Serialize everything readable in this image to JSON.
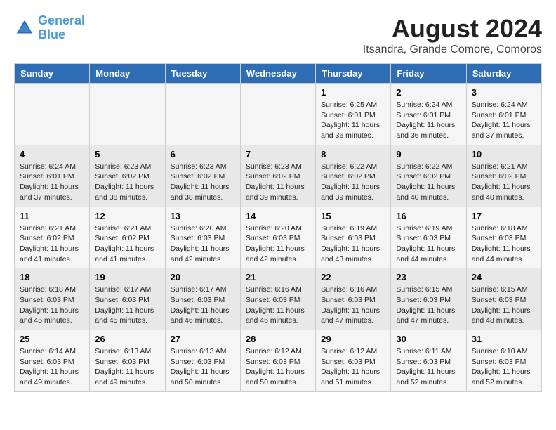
{
  "header": {
    "logo_line1": "General",
    "logo_line2": "Blue",
    "month_year": "August 2024",
    "location": "Itsandra, Grande Comore, Comoros"
  },
  "weekdays": [
    "Sunday",
    "Monday",
    "Tuesday",
    "Wednesday",
    "Thursday",
    "Friday",
    "Saturday"
  ],
  "weeks": [
    [
      {
        "day": "",
        "info": ""
      },
      {
        "day": "",
        "info": ""
      },
      {
        "day": "",
        "info": ""
      },
      {
        "day": "",
        "info": ""
      },
      {
        "day": "1",
        "info": "Sunrise: 6:25 AM\nSunset: 6:01 PM\nDaylight: 11 hours and 36 minutes."
      },
      {
        "day": "2",
        "info": "Sunrise: 6:24 AM\nSunset: 6:01 PM\nDaylight: 11 hours and 36 minutes."
      },
      {
        "day": "3",
        "info": "Sunrise: 6:24 AM\nSunset: 6:01 PM\nDaylight: 11 hours and 37 minutes."
      }
    ],
    [
      {
        "day": "4",
        "info": "Sunrise: 6:24 AM\nSunset: 6:01 PM\nDaylight: 11 hours and 37 minutes."
      },
      {
        "day": "5",
        "info": "Sunrise: 6:23 AM\nSunset: 6:02 PM\nDaylight: 11 hours and 38 minutes."
      },
      {
        "day": "6",
        "info": "Sunrise: 6:23 AM\nSunset: 6:02 PM\nDaylight: 11 hours and 38 minutes."
      },
      {
        "day": "7",
        "info": "Sunrise: 6:23 AM\nSunset: 6:02 PM\nDaylight: 11 hours and 39 minutes."
      },
      {
        "day": "8",
        "info": "Sunrise: 6:22 AM\nSunset: 6:02 PM\nDaylight: 11 hours and 39 minutes."
      },
      {
        "day": "9",
        "info": "Sunrise: 6:22 AM\nSunset: 6:02 PM\nDaylight: 11 hours and 40 minutes."
      },
      {
        "day": "10",
        "info": "Sunrise: 6:21 AM\nSunset: 6:02 PM\nDaylight: 11 hours and 40 minutes."
      }
    ],
    [
      {
        "day": "11",
        "info": "Sunrise: 6:21 AM\nSunset: 6:02 PM\nDaylight: 11 hours and 41 minutes."
      },
      {
        "day": "12",
        "info": "Sunrise: 6:21 AM\nSunset: 6:02 PM\nDaylight: 11 hours and 41 minutes."
      },
      {
        "day": "13",
        "info": "Sunrise: 6:20 AM\nSunset: 6:03 PM\nDaylight: 11 hours and 42 minutes."
      },
      {
        "day": "14",
        "info": "Sunrise: 6:20 AM\nSunset: 6:03 PM\nDaylight: 11 hours and 42 minutes."
      },
      {
        "day": "15",
        "info": "Sunrise: 6:19 AM\nSunset: 6:03 PM\nDaylight: 11 hours and 43 minutes."
      },
      {
        "day": "16",
        "info": "Sunrise: 6:19 AM\nSunset: 6:03 PM\nDaylight: 11 hours and 44 minutes."
      },
      {
        "day": "17",
        "info": "Sunrise: 6:18 AM\nSunset: 6:03 PM\nDaylight: 11 hours and 44 minutes."
      }
    ],
    [
      {
        "day": "18",
        "info": "Sunrise: 6:18 AM\nSunset: 6:03 PM\nDaylight: 11 hours and 45 minutes."
      },
      {
        "day": "19",
        "info": "Sunrise: 6:17 AM\nSunset: 6:03 PM\nDaylight: 11 hours and 45 minutes."
      },
      {
        "day": "20",
        "info": "Sunrise: 6:17 AM\nSunset: 6:03 PM\nDaylight: 11 hours and 46 minutes."
      },
      {
        "day": "21",
        "info": "Sunrise: 6:16 AM\nSunset: 6:03 PM\nDaylight: 11 hours and 46 minutes."
      },
      {
        "day": "22",
        "info": "Sunrise: 6:16 AM\nSunset: 6:03 PM\nDaylight: 11 hours and 47 minutes."
      },
      {
        "day": "23",
        "info": "Sunrise: 6:15 AM\nSunset: 6:03 PM\nDaylight: 11 hours and 47 minutes."
      },
      {
        "day": "24",
        "info": "Sunrise: 6:15 AM\nSunset: 6:03 PM\nDaylight: 11 hours and 48 minutes."
      }
    ],
    [
      {
        "day": "25",
        "info": "Sunrise: 6:14 AM\nSunset: 6:03 PM\nDaylight: 11 hours and 49 minutes."
      },
      {
        "day": "26",
        "info": "Sunrise: 6:13 AM\nSunset: 6:03 PM\nDaylight: 11 hours and 49 minutes."
      },
      {
        "day": "27",
        "info": "Sunrise: 6:13 AM\nSunset: 6:03 PM\nDaylight: 11 hours and 50 minutes."
      },
      {
        "day": "28",
        "info": "Sunrise: 6:12 AM\nSunset: 6:03 PM\nDaylight: 11 hours and 50 minutes."
      },
      {
        "day": "29",
        "info": "Sunrise: 6:12 AM\nSunset: 6:03 PM\nDaylight: 11 hours and 51 minutes."
      },
      {
        "day": "30",
        "info": "Sunrise: 6:11 AM\nSunset: 6:03 PM\nDaylight: 11 hours and 52 minutes."
      },
      {
        "day": "31",
        "info": "Sunrise: 6:10 AM\nSunset: 6:03 PM\nDaylight: 11 hours and 52 minutes."
      }
    ]
  ]
}
